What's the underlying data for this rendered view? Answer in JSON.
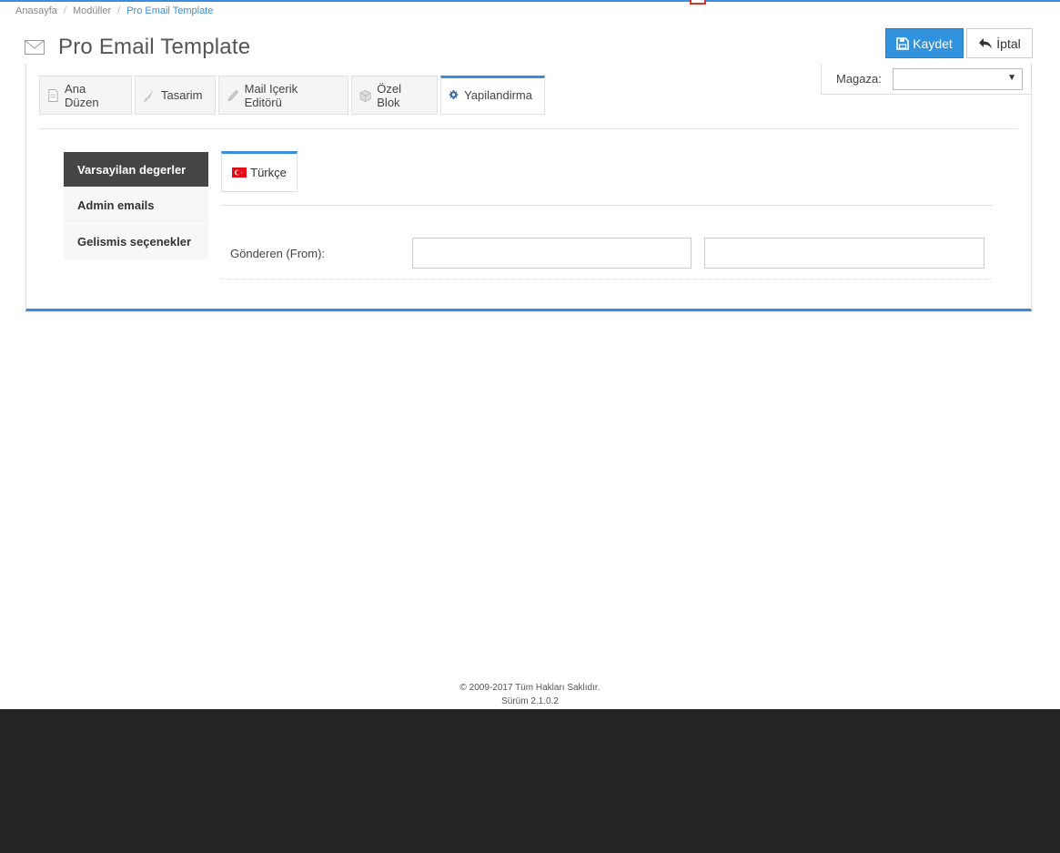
{
  "breadcrumb": {
    "items": [
      "Anasayfa",
      "Modüller"
    ],
    "current": "Pro Email Template",
    "separator": "/"
  },
  "header": {
    "title": "Pro Email Template",
    "icon": "envelope-icon"
  },
  "actions": {
    "save_label": "Kaydet",
    "cancel_label": "İptal"
  },
  "store": {
    "label": "Magaza:",
    "selected": ""
  },
  "tabs": [
    {
      "label": "Ana Düzen",
      "icon": "document-icon"
    },
    {
      "label": "Tasarim",
      "icon": "brush-icon"
    },
    {
      "label": "Mail Içerik Editörü",
      "icon": "pencil-icon"
    },
    {
      "label": "Özel Blok",
      "icon": "box-icon"
    },
    {
      "label": "Yapilandirma",
      "icon": "gear-icon",
      "active": true
    }
  ],
  "side_nav": [
    {
      "label": "Varsayilan degerler",
      "active": true
    },
    {
      "label": "Admin emails"
    },
    {
      "label": "Gelismis seçenekler"
    }
  ],
  "language_tab": {
    "label": "Türkçe",
    "icon": "turkey-flag-icon"
  },
  "form": {
    "from_label": "Gönderen (From):",
    "from_name_value": "",
    "from_email_value": ""
  },
  "footer": {
    "copyright": "© 2009-2017 Tüm Hakları Saklıdır.",
    "version": "Sürüm 2.1.0.2"
  },
  "colors": {
    "accent": "#3c8dde",
    "save_button": "#3192dd",
    "active_nav": "#454545",
    "footer_band": "#252525"
  }
}
